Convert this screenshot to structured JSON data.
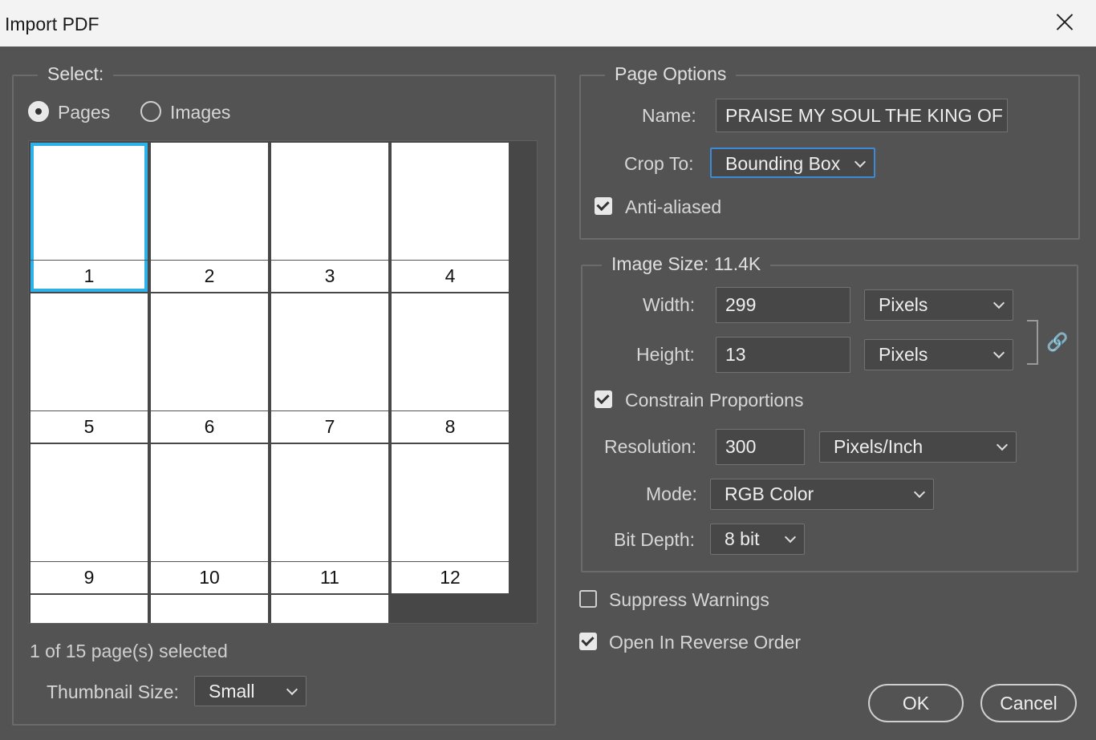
{
  "window": {
    "title": "Import PDF"
  },
  "select_group": {
    "legend": "Select:",
    "radio_pages": "Pages",
    "radio_images": "Images",
    "pages": [
      "1",
      "2",
      "3",
      "4",
      "5",
      "6",
      "7",
      "8",
      "9",
      "10",
      "11",
      "12",
      "",
      "",
      ""
    ],
    "selected_page": "1",
    "status": "1 of 15 page(s) selected",
    "thumb_size_label": "Thumbnail Size:",
    "thumb_size_value": "Small"
  },
  "page_options": {
    "legend": "Page Options",
    "name_label": "Name:",
    "name_value": "PRAISE MY SOUL THE KING OF",
    "crop_label": "Crop To:",
    "crop_value": "Bounding Box",
    "anti_aliased_label": "Anti-aliased",
    "anti_aliased": true
  },
  "image_size": {
    "legend": "Image Size: 11.4K",
    "width_label": "Width:",
    "width_value": "299",
    "width_unit": "Pixels",
    "height_label": "Height:",
    "height_value": "13",
    "height_unit": "Pixels",
    "constrain_label": "Constrain Proportions",
    "constrain": true,
    "resolution_label": "Resolution:",
    "resolution_value": "300",
    "resolution_unit": "Pixels/Inch",
    "mode_label": "Mode:",
    "mode_value": "RGB Color",
    "bitdepth_label": "Bit Depth:",
    "bitdepth_value": "8 bit"
  },
  "options": {
    "suppress_label": "Suppress Warnings",
    "suppress": false,
    "reverse_label": "Open In Reverse Order",
    "reverse": true
  },
  "buttons": {
    "ok": "OK",
    "cancel": "Cancel"
  },
  "icons": {
    "link": "link-icon",
    "close": "close-icon"
  },
  "colors": {
    "selection": "#2cb1e8",
    "background": "#535353"
  }
}
